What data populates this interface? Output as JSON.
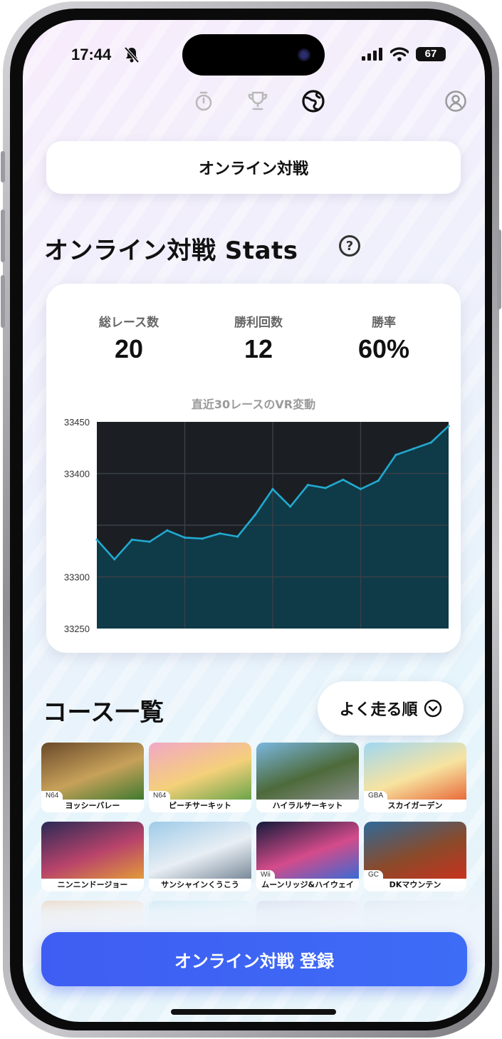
{
  "status_bar": {
    "time": "17:44",
    "battery": "67",
    "icons": [
      "bell-slash-icon",
      "signal-icon",
      "wifi-icon",
      "battery-icon"
    ]
  },
  "top_nav": {
    "icons": [
      "stopwatch-icon",
      "trophy-icon",
      "online-globe-icon",
      "profile-icon"
    ],
    "active": "online-globe-icon"
  },
  "mode_tab": {
    "label": "オンライン対戦"
  },
  "stats_section": {
    "title": "オンライン対戦 Stats",
    "help_label": "?",
    "stats": [
      {
        "label": "総レース数",
        "value": "20"
      },
      {
        "label": "勝利回数",
        "value": "12"
      },
      {
        "label": "勝率",
        "value": "60%"
      }
    ]
  },
  "chart_data": {
    "type": "area",
    "title": "直近30レースのVR変動",
    "xlabel": "",
    "ylabel": "",
    "ylim": [
      33250,
      33450
    ],
    "yticks": [
      "33450",
      "33400",
      "33300",
      "33250"
    ],
    "grid": true,
    "series": [
      {
        "values": [
          33336,
          33317,
          33336,
          33334,
          33345,
          33338,
          33337,
          33342,
          33339,
          33360,
          33385,
          33368,
          33389,
          33386,
          33394,
          33385,
          33393,
          33418,
          33424,
          33430,
          33446
        ]
      }
    ],
    "colors": {
      "line": "#22a9d0",
      "fill": "#0f3a48",
      "plot_bg": "#1b1f24",
      "grid": "#3a4048"
    }
  },
  "courses_section": {
    "title": "コース一覧",
    "sort_label": "よく走る順",
    "courses": [
      {
        "name": "ヨッシーバレー",
        "platform": "N64",
        "colors": [
          "#6a4a2a",
          "#c7a15a",
          "#3f7a2f"
        ]
      },
      {
        "name": "ピーチサーキット",
        "platform": "N64",
        "colors": [
          "#f2a7c6",
          "#f4d07a",
          "#6aa54a"
        ]
      },
      {
        "name": "ハイラルサーキット",
        "platform": "",
        "colors": [
          "#7ab7e0",
          "#4d6a3a",
          "#8a8f8c"
        ]
      },
      {
        "name": "スカイガーデン",
        "platform": "GBA",
        "colors": [
          "#9fd7f2",
          "#f7e3a0",
          "#e86b3a"
        ]
      },
      {
        "name": "ニンニンドージョー",
        "platform": "",
        "colors": [
          "#2a2a55",
          "#b8436b",
          "#e29a3a"
        ]
      },
      {
        "name": "サンシャインくうこう",
        "platform": "",
        "colors": [
          "#9ecbe8",
          "#e8eef4",
          "#7a8a99"
        ]
      },
      {
        "name": "ムーンリッジ&ハイウェイ",
        "platform": "Wii",
        "colors": [
          "#141a3a",
          "#d44b8a",
          "#3a6ad4"
        ]
      },
      {
        "name": "DKマウンテン",
        "platform": "GC",
        "colors": [
          "#2e6a9a",
          "#8a4a2a",
          "#c8321e"
        ]
      }
    ],
    "faded_row_colors": [
      "#e9c8a6",
      "#bfe6f2",
      "#cfd5ea",
      "#d7e4f0"
    ]
  },
  "cta": {
    "label": "オンライン対戦 登録"
  }
}
